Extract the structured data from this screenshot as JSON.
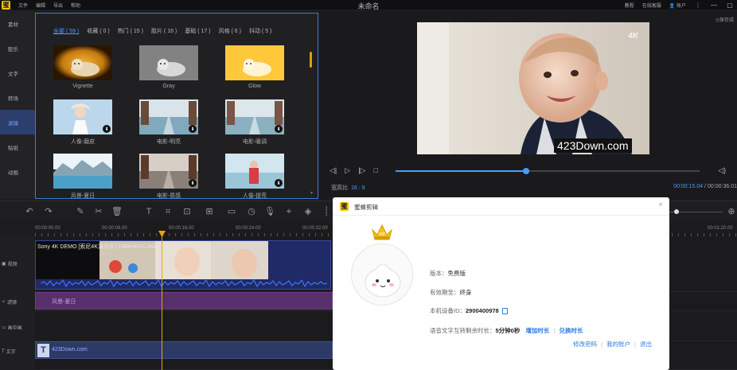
{
  "app": {
    "title": "未命名",
    "logo_glyph": "蜜",
    "menu": [
      "文件",
      "编辑",
      "导出",
      "帮助"
    ],
    "right_menu": {
      "tutorial": "教程",
      "online_feedback": "在线客服",
      "account": "账户"
    },
    "window_controls": {
      "more": "⋮",
      "minimize": "—",
      "restore": "▢"
    }
  },
  "left_tabs": [
    {
      "label": "素材",
      "active": false
    },
    {
      "label": "配乐",
      "active": false
    },
    {
      "label": "文字",
      "active": false
    },
    {
      "label": "转场",
      "active": false
    },
    {
      "label": "滤镜",
      "active": true
    },
    {
      "label": "贴纸",
      "active": false
    },
    {
      "label": "动画",
      "active": false
    }
  ],
  "filter_panel": {
    "categories": [
      "全部 ( 59 )",
      "收藏 ( 0 )",
      "热门 ( 15 )",
      "胶片 ( 16 )",
      "基础 ( 17 )",
      "风格 ( 6 )",
      "抖动 ( 5 )"
    ],
    "items": [
      {
        "label": "Vignette",
        "downloadable": false
      },
      {
        "label": "Gray",
        "downloadable": false
      },
      {
        "label": "Glow",
        "downloadable": false
      },
      {
        "label": "人像-磨皮",
        "downloadable": true
      },
      {
        "label": "电影-明亮",
        "downloadable": true
      },
      {
        "label": "电影-暖调",
        "downloadable": true
      },
      {
        "label": "风景-夏日",
        "downloadable": false
      },
      {
        "label": "电影-质感",
        "downloadable": true
      },
      {
        "label": "人像-提亮",
        "downloadable": true
      }
    ]
  },
  "preview": {
    "autosave": "◷保存成",
    "watermark_4k": "4K",
    "watermark_site": "423Down.com",
    "aspect_label": "宽高比",
    "aspect_value": "16 : 9",
    "current_time": "00:00:15.04",
    "separator": " / ",
    "total_time": "00:00:36.01",
    "progress": 0.43
  },
  "timeline": {
    "ruler_labels": [
      "00:00:00.00",
      "00:00:08.00",
      "00:00:16.00",
      "00:00:24.00",
      "00:00:32.00",
      "00:01:20.00"
    ],
    "tracks": [
      {
        "label": "视频"
      },
      {
        "label": "滤镜"
      },
      {
        "label": "画中画"
      },
      {
        "label": "文字"
      }
    ],
    "video_clip_title": "Sony 4K DEMO [索尼4K演示片]-12BitHEVC.mkv",
    "filter_clip_label": "风景-夏日",
    "text_clip_label": "423Down.com",
    "text_clip_glyph": "T"
  },
  "dialog": {
    "title": "蜜蜂剪辑",
    "close": "×",
    "vip_badge": "VIP",
    "version_label": "版本：",
    "version_value": "免费版",
    "validity_label": "有效期至：",
    "validity_value": "终身",
    "device_label": "本机设备ID：",
    "device_value": "2900400978",
    "speech_label": "语音文字互转剩余时长：",
    "speech_value": "5分钟0秒",
    "add_time": "增加时长",
    "redeem_time": "兑换时长",
    "links": [
      "修改密码",
      "我的账户",
      "退出"
    ]
  }
}
